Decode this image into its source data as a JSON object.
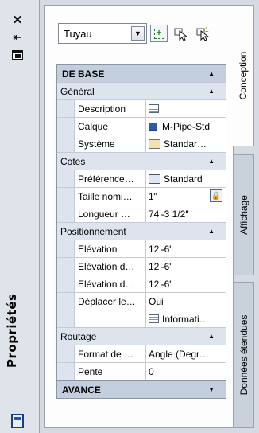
{
  "strip": {
    "title": "Propriétés",
    "close_icon": "close-icon",
    "autohide_icon": "autohide-icon",
    "menu_icon": "properties-menu-icon",
    "bottom_icon": "properties-palette-icon"
  },
  "toolbar": {
    "object_type": "Tuyau",
    "quick_select_icon": "quick-select-icon",
    "select_objects_icon": "select-objects-icon",
    "pickadd_icon": "pickadd-toggle-icon"
  },
  "tabs": [
    "Conception",
    "Affichage",
    "Données étendues"
  ],
  "grid": {
    "basic": {
      "label": "DE BASE"
    },
    "general": {
      "label": "Général",
      "rows": [
        {
          "name": "Description",
          "value": "",
          "icon": "description-icon"
        },
        {
          "name": "Calque",
          "value": "M-Pipe-Std",
          "icon": "layer-color-icon"
        },
        {
          "name": "Système",
          "value": "Standar…",
          "icon": "system-icon"
        }
      ]
    },
    "cotes": {
      "label": "Cotes",
      "rows": [
        {
          "name": "Préférence…",
          "value": "Standard",
          "icon": "preference-icon"
        },
        {
          "name": "Taille nomi…",
          "value": "1\"",
          "icon": "lock-icon"
        },
        {
          "name": "Longueur …",
          "value": "74'-3 1/2\""
        }
      ]
    },
    "position": {
      "label": "Positionnement",
      "rows": [
        {
          "name": "Elévation",
          "value": "12'-6\""
        },
        {
          "name": "Elévation d…",
          "value": "12'-6\""
        },
        {
          "name": "Elévation d…",
          "value": "12'-6\""
        },
        {
          "name": "Déplacer le…",
          "value": "Oui"
        },
        {
          "name": "",
          "value": "Informati…",
          "icon": "info-icon"
        }
      ]
    },
    "routage": {
      "label": "Routage",
      "rows": [
        {
          "name": "Format de …",
          "value": "Angle (Degr…"
        },
        {
          "name": "Pente",
          "value": "0"
        }
      ]
    },
    "advanced": {
      "label": "AVANCE"
    }
  }
}
